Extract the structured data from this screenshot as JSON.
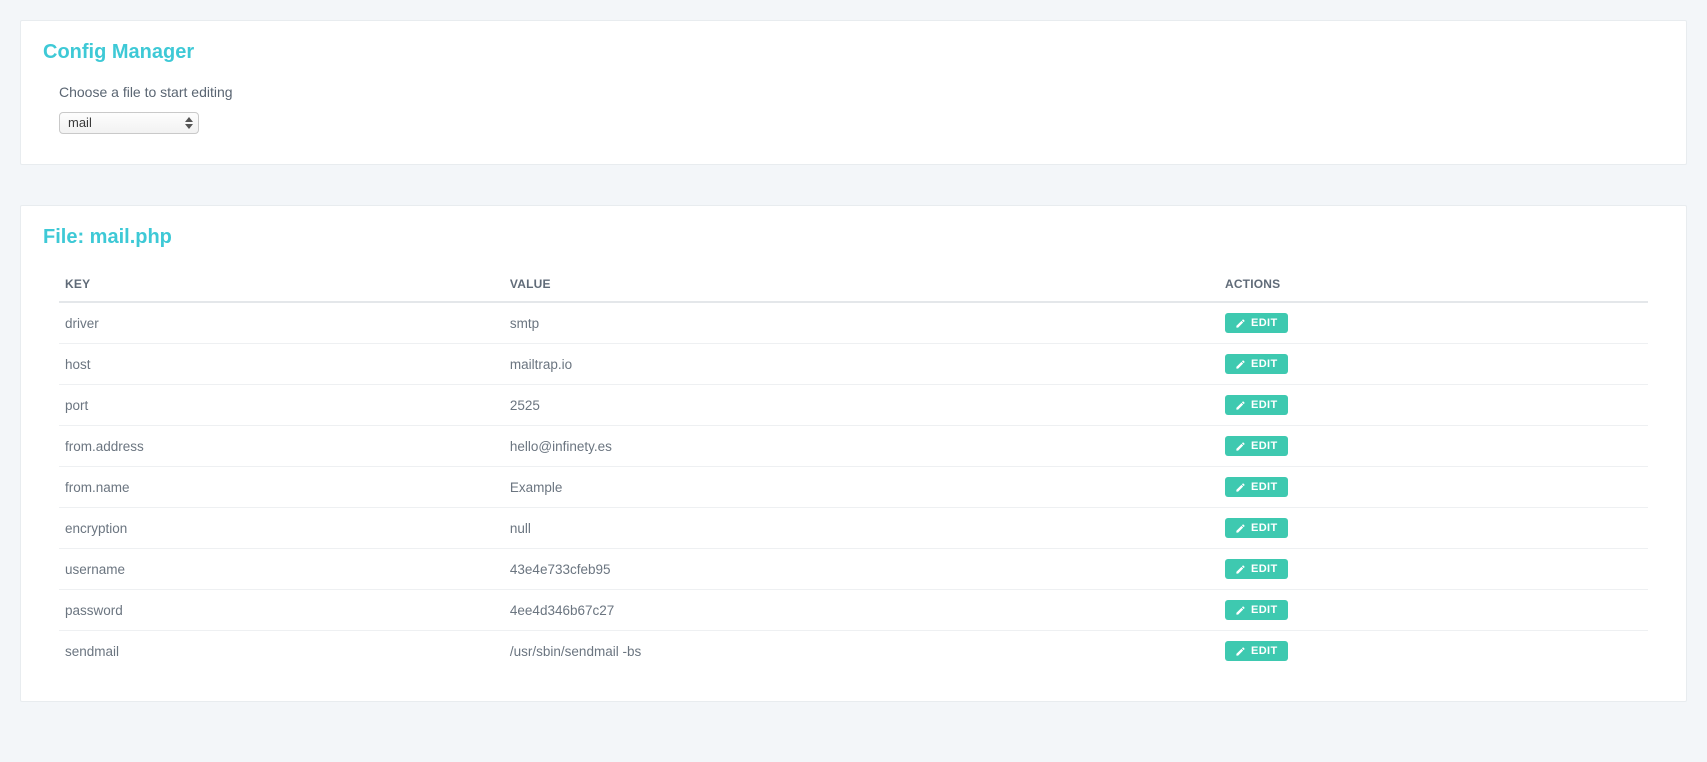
{
  "manager": {
    "title": "Config Manager",
    "choose_label": "Choose a file to start editing",
    "selected": "mail"
  },
  "file": {
    "title": "File: mail.php",
    "columns": {
      "key": "KEY",
      "value": "VALUE",
      "actions": "ACTIONS"
    },
    "edit_label": "EDIT",
    "rows": [
      {
        "key": "driver",
        "value": "smtp"
      },
      {
        "key": "host",
        "value": "mailtrap.io"
      },
      {
        "key": "port",
        "value": "2525"
      },
      {
        "key": "from.address",
        "value": "hello@infinety.es"
      },
      {
        "key": "from.name",
        "value": "Example"
      },
      {
        "key": "encryption",
        "value": "null"
      },
      {
        "key": "username",
        "value": "43e4e733cfeb95"
      },
      {
        "key": "password",
        "value": "4ee4d346b67c27"
      },
      {
        "key": "sendmail",
        "value": "/usr/sbin/sendmail -bs"
      }
    ]
  }
}
